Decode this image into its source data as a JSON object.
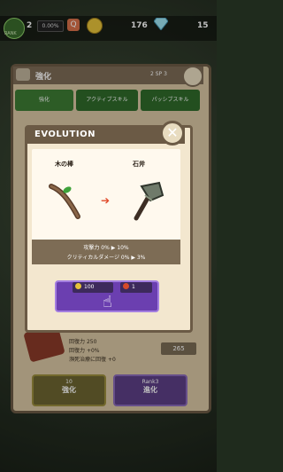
{
  "topbar": {
    "rank_label": "RANK",
    "level": "2",
    "progress": "0.00%",
    "up_symbol": "Q",
    "coins": "176",
    "gems": "15"
  },
  "panel": {
    "title": "強化",
    "sp_label": "SP",
    "sp_left": "2",
    "sp_right": "3",
    "tabs": [
      "強化",
      "アクティブスキル",
      "パッシブスキル"
    ],
    "stats": [
      {
        "label": "回復力",
        "value": "250"
      },
      {
        "label": "回復力",
        "value": "+0%"
      },
      {
        "label": "瀕死治療に回復",
        "value": "+0"
      }
    ],
    "stat_value_box": "265",
    "strength_button": {
      "cost": "10",
      "label": "強化"
    },
    "evolve_button": {
      "rank": "Rank3",
      "label": "進化"
    }
  },
  "modal": {
    "title": "EVOLUTION",
    "from_item": "木の棒",
    "to_item": "石斧",
    "stat_attack": "攻撃力 0% ▶ 10%",
    "stat_crit": "クリティカルダメージ 0% ▶ 3%",
    "coin_cost": "100",
    "material_cost": "1"
  },
  "colors": {
    "modal_border": "#6b5a45",
    "evolve_purple": "#6b3fb0",
    "arrow_red": "#e04a2a"
  }
}
